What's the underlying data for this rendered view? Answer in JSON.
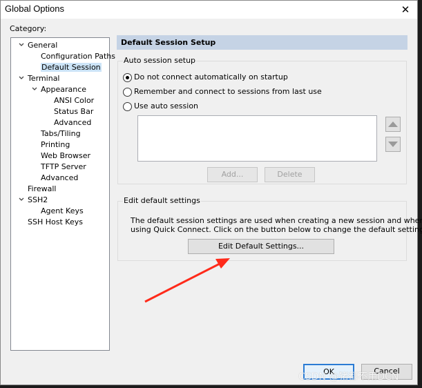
{
  "window": {
    "title": "Global Options"
  },
  "category": {
    "label": "Category:"
  },
  "tree": [
    {
      "label": "General",
      "level": 0,
      "expanded": true
    },
    {
      "label": "Configuration Paths",
      "level": 1
    },
    {
      "label": "Default Session",
      "level": 1,
      "selected": true
    },
    {
      "label": "Terminal",
      "level": 0,
      "expanded": true
    },
    {
      "label": "Appearance",
      "level": 1,
      "expanded": true
    },
    {
      "label": "ANSI Color",
      "level": 2
    },
    {
      "label": "Status Bar",
      "level": 2
    },
    {
      "label": "Advanced",
      "level": 2
    },
    {
      "label": "Tabs/Tiling",
      "level": 1
    },
    {
      "label": "Printing",
      "level": 1
    },
    {
      "label": "Web Browser",
      "level": 1
    },
    {
      "label": "TFTP Server",
      "level": 1
    },
    {
      "label": "Advanced",
      "level": 1
    },
    {
      "label": "Firewall",
      "level": 0
    },
    {
      "label": "SSH2",
      "level": 0,
      "expanded": true
    },
    {
      "label": "Agent Keys",
      "level": 1
    },
    {
      "label": "SSH Host Keys",
      "level": 0
    }
  ],
  "panel": {
    "header": "Default Session Setup",
    "auto": {
      "title": "Auto session setup",
      "options": [
        {
          "label": "Do not connect automatically on startup",
          "checked": true
        },
        {
          "label": "Remember and connect to sessions from last use",
          "checked": false
        },
        {
          "label": "Use auto session",
          "checked": false
        }
      ],
      "add_label": "Add...",
      "delete_label": "Delete"
    },
    "edit": {
      "title": "Edit default settings",
      "desc_line1": "The default session settings are used when creating a new session and when",
      "desc_line2": "using Quick Connect.  Click on the button below to change the default settings.",
      "button_label": "Edit Default Settings..."
    }
  },
  "footer": {
    "ok_label": "OK",
    "cancel_label": "Cancel"
  },
  "watermark": "CSDN @猪都不用DCN",
  "colors": {
    "header_bg": "#c5d3e5",
    "selected_bg": "#cce4f7",
    "arrow": "#ff2a1a",
    "ok_border": "#2a7bd4"
  }
}
